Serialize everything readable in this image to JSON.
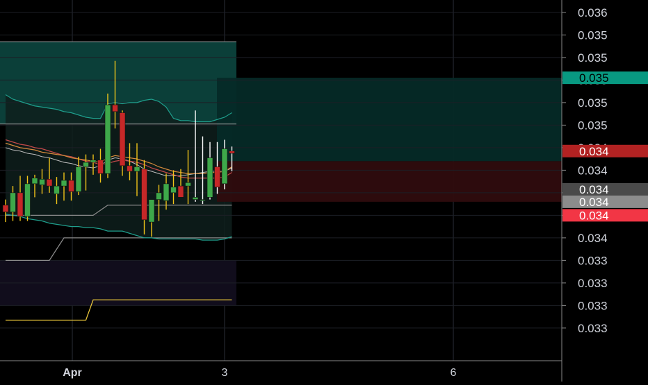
{
  "chart_data": {
    "type": "candlestick",
    "x_labels": [
      {
        "label": "Apr",
        "bar": 5
      },
      {
        "label": "3",
        "bar": 20
      },
      {
        "label": "6",
        "bar": 41
      }
    ],
    "y_axis": {
      "min": 0.0326,
      "max": 0.0358,
      "tick_values": [
        0.03569,
        0.03549,
        0.03529,
        0.03509,
        0.03489,
        0.03469,
        0.03449,
        0.03429,
        0.03409,
        0.03389,
        0.03369,
        0.03349,
        0.03329,
        0.03309,
        0.03289
      ],
      "tick_labels": [
        "0.036",
        "0.035",
        "0.035",
        "0.035",
        "0.035",
        "0.035",
        "0.034",
        "0.034",
        "0.034",
        "0.034",
        "0.034",
        "0.033",
        "0.033",
        "0.033",
        "0.033"
      ]
    },
    "price_tags": [
      {
        "label": "0.035",
        "value": 0.03511,
        "color": "#089981",
        "text_color": "#000000"
      },
      {
        "label": "0.034",
        "value": 0.03446,
        "color": "#b22222",
        "text_color": "#ffffff"
      },
      {
        "label": "0.034",
        "value": 0.03412,
        "color": "#4a4a4a",
        "text_color": "#ffffff"
      },
      {
        "label": "0.034",
        "value": 0.03401,
        "color": "#8c8c8c",
        "text_color": "#ffffff"
      },
      {
        "label": "0.034",
        "value": 0.03389,
        "color": "#f23645",
        "text_color": "#ffffff"
      }
    ],
    "candles": [
      {
        "o": 0.03398,
        "h": 0.03403,
        "l": 0.03383,
        "c": 0.03392
      },
      {
        "o": 0.03392,
        "h": 0.03415,
        "l": 0.03384,
        "c": 0.03409
      },
      {
        "o": 0.03409,
        "h": 0.03424,
        "l": 0.03384,
        "c": 0.03388
      },
      {
        "o": 0.03388,
        "h": 0.03424,
        "l": 0.03384,
        "c": 0.03417
      },
      {
        "o": 0.03417,
        "h": 0.03425,
        "l": 0.03405,
        "c": 0.03422
      },
      {
        "o": 0.03416,
        "h": 0.0343,
        "l": 0.03408,
        "c": 0.03421
      },
      {
        "o": 0.03421,
        "h": 0.0344,
        "l": 0.03409,
        "c": 0.03415
      },
      {
        "o": 0.03408,
        "h": 0.03423,
        "l": 0.03399,
        "c": 0.03415
      },
      {
        "o": 0.03415,
        "h": 0.03427,
        "l": 0.03402,
        "c": 0.0342
      },
      {
        "o": 0.0342,
        "h": 0.03427,
        "l": 0.03402,
        "c": 0.0341
      },
      {
        "o": 0.0341,
        "h": 0.03441,
        "l": 0.03407,
        "c": 0.03432
      },
      {
        "o": 0.03432,
        "h": 0.03443,
        "l": 0.03411,
        "c": 0.03436
      },
      {
        "o": 0.03436,
        "h": 0.03443,
        "l": 0.03425,
        "c": 0.03438
      },
      {
        "o": 0.03438,
        "h": 0.03448,
        "l": 0.03418,
        "c": 0.03426
      },
      {
        "o": 0.03426,
        "h": 0.03497,
        "l": 0.03422,
        "c": 0.03487
      },
      {
        "o": 0.03487,
        "h": 0.03526,
        "l": 0.03466,
        "c": 0.03481
      },
      {
        "o": 0.0348,
        "h": 0.03482,
        "l": 0.03424,
        "c": 0.03433
      },
      {
        "o": 0.03433,
        "h": 0.03453,
        "l": 0.0342,
        "c": 0.03428
      },
      {
        "o": 0.03428,
        "h": 0.03453,
        "l": 0.03406,
        "c": 0.03432
      },
      {
        "o": 0.0343,
        "h": 0.03438,
        "l": 0.03372,
        "c": 0.03385
      },
      {
        "o": 0.03383,
        "h": 0.03401,
        "l": 0.0337,
        "c": 0.03403
      },
      {
        "o": 0.03403,
        "h": 0.03416,
        "l": 0.03384,
        "c": 0.03409
      },
      {
        "o": 0.03402,
        "h": 0.03426,
        "l": 0.03394,
        "c": 0.03417
      },
      {
        "o": 0.03409,
        "h": 0.03429,
        "l": 0.03399,
        "c": 0.03414
      },
      {
        "o": 0.03415,
        "h": 0.0343,
        "l": 0.03409,
        "c": 0.03405
      },
      {
        "o": 0.03415,
        "h": 0.03447,
        "l": 0.03399,
        "c": 0.03418
      },
      {
        "o": 0.03403,
        "h": 0.03482,
        "l": 0.03401,
        "c": 0.03405
      },
      {
        "o": 0.03402,
        "h": 0.03459,
        "l": 0.03399,
        "c": 0.03403
      },
      {
        "o": 0.03405,
        "h": 0.03454,
        "l": 0.03403,
        "c": 0.0344
      },
      {
        "o": 0.03432,
        "h": 0.03454,
        "l": 0.03408,
        "c": 0.03414
      },
      {
        "o": 0.03417,
        "h": 0.03456,
        "l": 0.03412,
        "c": 0.03448
      },
      {
        "o": 0.03446,
        "h": 0.0345,
        "l": 0.03428,
        "c": 0.03444
      }
    ],
    "bands": {
      "upper_fill": [
        0.03496,
        0.03492,
        0.0349,
        0.03488,
        0.03486,
        0.03485,
        0.03484,
        0.03483,
        0.03481,
        0.0348,
        0.03478,
        0.03476,
        0.03475,
        0.03475,
        0.03488,
        0.03489,
        0.03488,
        0.03489,
        0.03489,
        0.03491,
        0.03492,
        0.0349,
        0.03485,
        0.03475,
        0.03473,
        0.03473,
        0.03472,
        0.03472,
        0.03472,
        0.03474,
        0.03476,
        0.0348
      ],
      "midline": [
        0.03449,
        0.03447,
        0.03446,
        0.03444,
        0.03443,
        0.03441,
        0.0344,
        0.03438,
        0.03436,
        0.03435,
        0.03433,
        0.03432,
        0.03431,
        0.03433,
        0.03438,
        0.0344,
        0.03439,
        0.03437,
        0.03434,
        0.0343,
        0.03428,
        0.03426,
        0.03424,
        0.03424,
        0.03424,
        0.03425,
        0.03426,
        0.03427,
        0.03428,
        0.03428,
        0.03428,
        0.03431
      ],
      "lower_fill": [
        0.0339,
        0.03389,
        0.03388,
        0.03386,
        0.03385,
        0.03384,
        0.03382,
        0.03381,
        0.0338,
        0.03379,
        0.03379,
        0.03378,
        0.03378,
        0.03377,
        0.03375,
        0.03375,
        0.03375,
        0.03373,
        0.03371,
        0.03369,
        0.03369,
        0.03368,
        0.03368,
        0.03368,
        0.03368,
        0.03368,
        0.03368,
        0.03367,
        0.03367,
        0.03367,
        0.03368,
        0.0337
      ],
      "red_ma": [
        0.03456,
        0.03454,
        0.03452,
        0.03451,
        0.03449,
        0.03448,
        0.03446,
        0.03444,
        0.03442,
        0.03441,
        0.03439,
        0.03437,
        0.03436,
        0.03434,
        0.03435,
        0.03437,
        0.03438,
        0.03437,
        0.03436,
        0.03434,
        0.03431,
        0.03429,
        0.03427,
        0.03425,
        0.03423,
        0.03422,
        0.03422,
        0.03422,
        0.03422,
        0.03422,
        0.03423,
        0.03427
      ],
      "orange_ma": [
        0.03453,
        0.03451,
        0.03449,
        0.03448,
        0.03447,
        0.03445,
        0.03444,
        0.03443,
        0.03442,
        0.0344,
        0.03439,
        0.03438,
        0.03437,
        0.03436,
        0.0344,
        0.03442,
        0.03441,
        0.0344,
        0.03439,
        0.03437,
        0.03435,
        0.03432,
        0.0343,
        0.03428,
        0.03427,
        0.03426,
        0.03426,
        0.03426,
        0.03427,
        0.03427,
        0.03428,
        0.03432
      ]
    },
    "envelope_upper": {
      "start_value": 0.03469,
      "x_from_bar": 0.0,
      "to_value": 0.03469
    },
    "envelope_lower": [
      {
        "bar": 0,
        "value": 0.03389
      },
      {
        "bar": 12,
        "value": 0.03389
      },
      {
        "bar": 14,
        "value": 0.03398
      },
      {
        "bar": 31,
        "value": 0.03398
      }
    ],
    "gray_step": [
      {
        "bar": 0,
        "value": 0.03349
      },
      {
        "bar": 6,
        "value": 0.03349
      },
      {
        "bar": 8,
        "value": 0.03369
      },
      {
        "bar": 31,
        "value": 0.03369
      }
    ],
    "yellow_step": [
      {
        "bar": 0,
        "value": 0.03296
      },
      {
        "bar": 9,
        "value": 0.03296
      },
      {
        "bar": 11,
        "value": 0.03296
      },
      {
        "bar": 12,
        "value": 0.03314
      },
      {
        "bar": 31,
        "value": 0.03314
      }
    ],
    "zones": {
      "upper_channel": {
        "top": 0.03543,
        "bottom": 0.0347,
        "color": "#0b3f39"
      },
      "lower_channel": {
        "top": 0.03349,
        "bottom": 0.03309,
        "color": "#110d1c"
      },
      "position_profit": {
        "top": 0.03511,
        "bottom": 0.03437,
        "color": "#052a27"
      },
      "position_loss": {
        "top": 0.03437,
        "bottom": 0.03401,
        "color": "#2f0c0e"
      }
    }
  }
}
